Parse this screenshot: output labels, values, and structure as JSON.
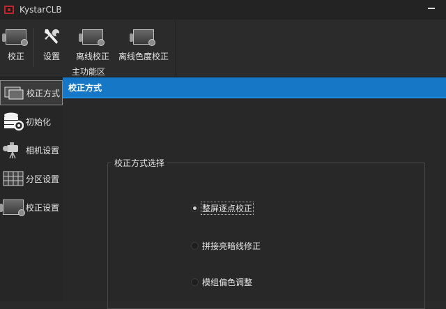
{
  "window": {
    "title": "KystarCLB"
  },
  "ribbon": {
    "buttons": [
      {
        "label": "校正",
        "icon": "monitor-calibrate-icon"
      },
      {
        "label": "设置",
        "icon": "tools-icon"
      },
      {
        "label": "离线校正",
        "icon": "monitor-offline-icon"
      },
      {
        "label": "离线色度校正",
        "icon": "monitor-chroma-icon"
      }
    ],
    "group_label": "主功能区"
  },
  "sidebar": {
    "items": [
      {
        "label": "校正方式",
        "icon": "display-icon",
        "active": true
      },
      {
        "label": "初始化",
        "icon": "database-gear-icon",
        "active": false
      },
      {
        "label": "相机设置",
        "icon": "camera-icon",
        "active": false
      },
      {
        "label": "分区设置",
        "icon": "grid-icon",
        "active": false
      },
      {
        "label": "校正设置",
        "icon": "monitor-icon",
        "active": false
      }
    ]
  },
  "main": {
    "header": "校正方式",
    "groupbox_title": "校正方式选择",
    "options": [
      {
        "label": "整屏逐点校正",
        "checked": true
      },
      {
        "label": "拼接亮暗线修正",
        "checked": false
      },
      {
        "label": "模组偏色调整",
        "checked": false
      }
    ]
  },
  "colors": {
    "accent": "#1677c6",
    "background": "#2a2a2a",
    "app_icon": "#c0262d"
  }
}
